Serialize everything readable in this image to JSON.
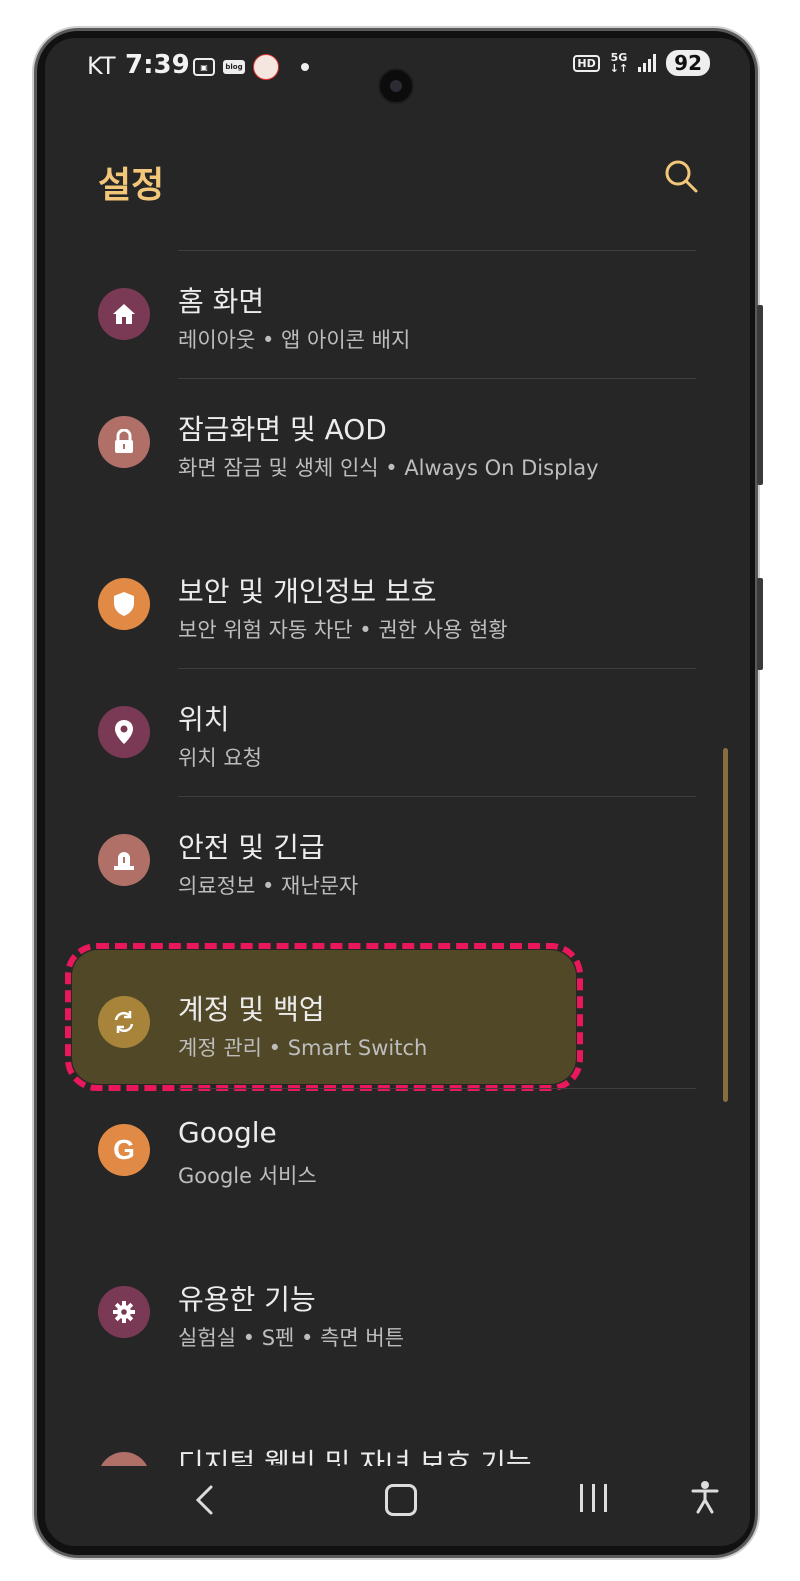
{
  "status_bar": {
    "carrier": "KT",
    "time": "7:39",
    "blog_icon_text": "blog",
    "hd": "HD",
    "network": "5G",
    "battery": "92"
  },
  "header": {
    "title": "설정"
  },
  "items": [
    {
      "label": "홈 화면",
      "sub": "레이아웃 • 앱 아이콘 배지",
      "icon": "home-icon",
      "color": "#7a3a55"
    },
    {
      "label": "잠금화면 및 AOD",
      "sub": "화면 잠금 및 생체 인식 • Always On Display",
      "icon": "lock-icon",
      "color": "#b07068"
    },
    {
      "label": "보안 및 개인정보 보호",
      "sub": "보안 위험 자동 차단 • 권한 사용 현황",
      "icon": "shield-icon",
      "color": "#e08a46"
    },
    {
      "label": "위치",
      "sub": "위치 요청",
      "icon": "location-pin-icon",
      "color": "#7a3a55"
    },
    {
      "label": "안전 및 긴급",
      "sub": "의료정보 • 재난문자",
      "icon": "emergency-light-icon",
      "color": "#b07068"
    },
    {
      "label": "계정 및 백업",
      "sub": "계정 관리 • Smart Switch",
      "icon": "sync-icon",
      "color": "#a8843a"
    },
    {
      "label": "Google",
      "sub": "Google 서비스",
      "icon": "google-g-icon",
      "color": "#e08a46"
    },
    {
      "label": "유용한 기능",
      "sub": "실험실 • S펜 • 측면 버튼",
      "icon": "gear-icon",
      "color": "#7a3a55"
    },
    {
      "label": "디지털 웰빙 및 자녀 보호 기능",
      "sub": "",
      "icon": "wellbeing-icon",
      "color": "#b07068"
    }
  ],
  "colors": {
    "background": "#262626",
    "title": "#f3c77a",
    "highlight_fill": "#504826",
    "highlight_border": "#e8185a"
  }
}
